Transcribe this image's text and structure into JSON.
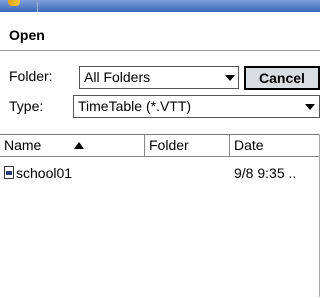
{
  "dialog": {
    "title": "Open"
  },
  "folder": {
    "label": "Folder:",
    "value": "All Folders"
  },
  "type": {
    "label": "Type:",
    "value": "TimeTable (*.VTT)"
  },
  "buttons": {
    "cancel": "Cancel"
  },
  "list": {
    "columns": [
      "Name",
      "Folder",
      "Date"
    ],
    "sort": {
      "column": "Name",
      "direction": "ascending"
    },
    "items": [
      {
        "name": "school01",
        "folder": "",
        "date": "9/8 9:35 .."
      }
    ]
  }
}
